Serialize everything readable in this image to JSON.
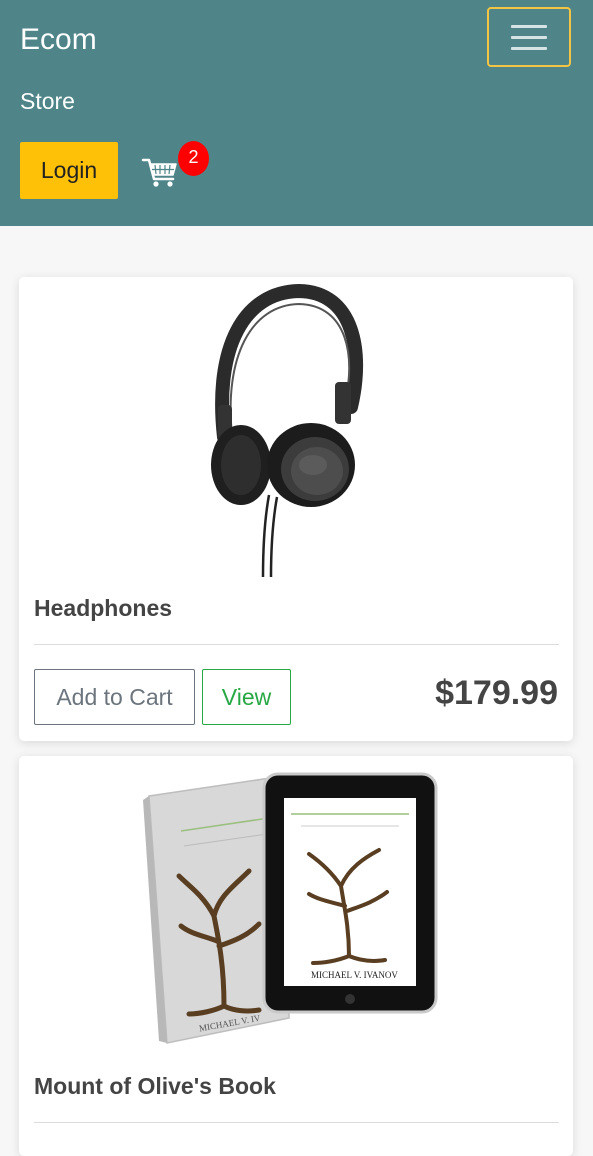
{
  "navbar": {
    "brand": "Ecom",
    "store_link": "Store",
    "login_label": "Login",
    "cart_count": "2",
    "toggler_icon": "hamburger-icon",
    "cart_icon": "shopping-cart-icon"
  },
  "products": [
    {
      "name": "Headphones",
      "add_to_cart_label": "Add to Cart",
      "view_label": "View",
      "price": "$179.99",
      "image": "headphones-image"
    },
    {
      "name": "Mount of Olive's Book",
      "image": "book-image"
    }
  ],
  "colors": {
    "navbar_bg": "#4f8588",
    "login_bg": "#ffc107",
    "badge": "#ff0000",
    "view_border": "#28a745",
    "cart_btn_border": "#6c757d"
  }
}
